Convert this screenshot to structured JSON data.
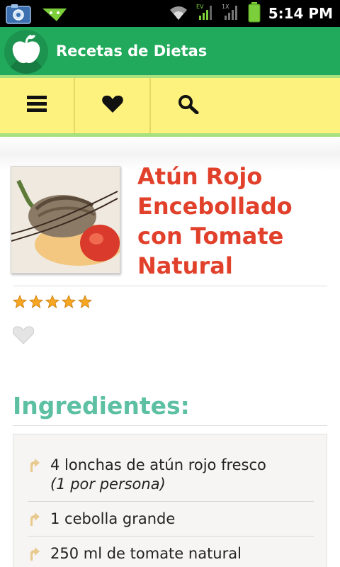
{
  "status_bar": {
    "time": "5:14 PM",
    "icons": [
      "camera-pro-icon",
      "android-usb-icon",
      "wifi-icon",
      "ev-signal-icon",
      "1x-signal-icon",
      "battery-icon"
    ],
    "camera_badge": "pro"
  },
  "app_bar": {
    "title": "Recetas de Dietas",
    "logo_icon": "apple-logo-icon",
    "color": "#21aa5b"
  },
  "toolbar": {
    "buttons": [
      {
        "name": "menu",
        "icon": "menu-icon"
      },
      {
        "name": "favorites",
        "icon": "heart-icon"
      },
      {
        "name": "search",
        "icon": "search-icon"
      }
    ],
    "color": "#fdf27e"
  },
  "recipe": {
    "title_lines": [
      "Atún Rojo",
      "Encebollado",
      "con Tomate",
      "Natural"
    ],
    "rating": 5,
    "rating_max": 5,
    "title_color": "#e1402b"
  },
  "ingredients": {
    "heading": "Ingredientes:",
    "heading_color": "#5dc0a3",
    "items": [
      {
        "text": "4 lonchas de atún rojo fresco",
        "note": "(1 por persona)"
      },
      {
        "text": "1 cebolla grande",
        "note": ""
      },
      {
        "text": "250 ml de tomate natural",
        "note": ""
      }
    ]
  }
}
